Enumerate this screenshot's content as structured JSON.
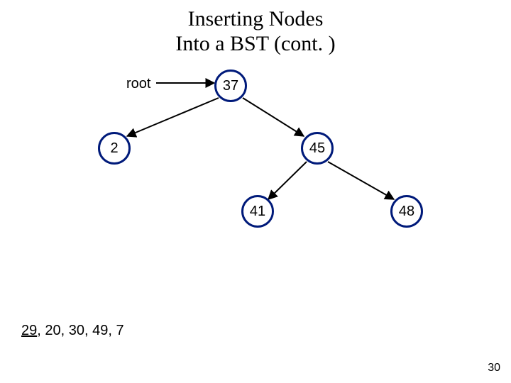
{
  "title_line1": "Inserting Nodes",
  "title_line2": "Into a BST (cont. )",
  "root_label": "root",
  "nodes": {
    "n37": "37",
    "n2": "2",
    "n45": "45",
    "n41": "41",
    "n48": "48"
  },
  "queue": {
    "underlined": "29",
    "rest": ", 20, 30, 49, 7"
  },
  "slide_number": "30",
  "chart_data": {
    "type": "diagram",
    "diagram_kind": "binary-search-tree-insertion",
    "root_pointer_to": 37,
    "tree": {
      "value": 37,
      "left": {
        "value": 2,
        "left": null,
        "right": null
      },
      "right": {
        "value": 45,
        "left": {
          "value": 41,
          "left": null,
          "right": null
        },
        "right": {
          "value": 48,
          "left": null,
          "right": null
        }
      }
    },
    "pending_insertions": [
      29,
      20,
      30,
      49,
      7
    ],
    "next_to_insert": 29
  }
}
